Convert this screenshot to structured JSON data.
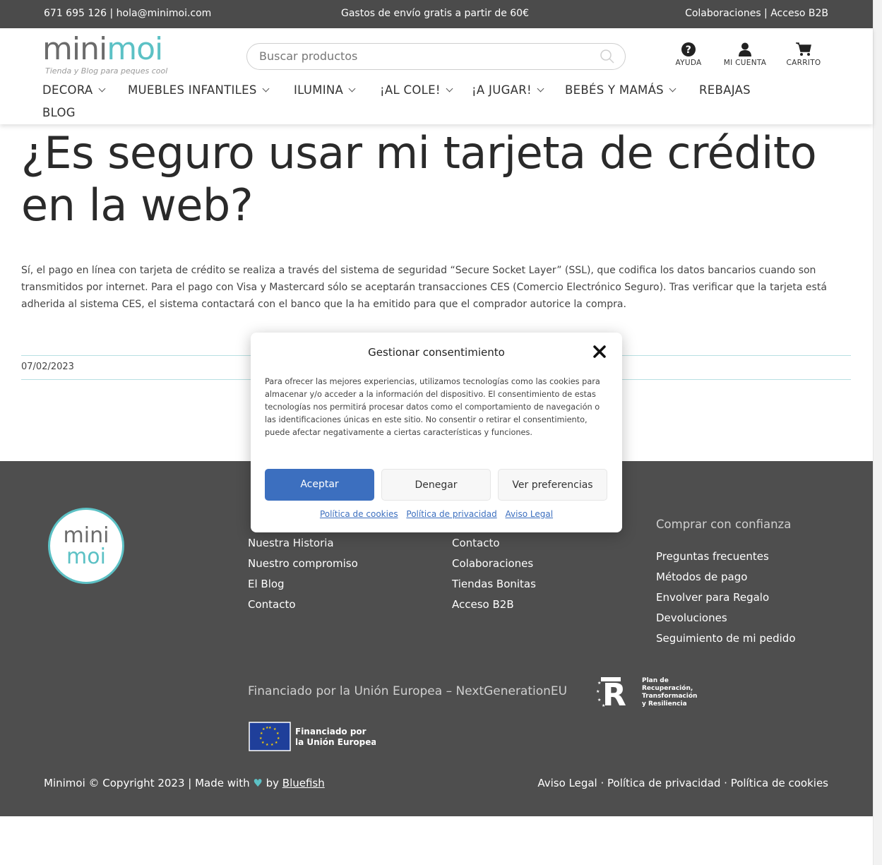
{
  "topbar": {
    "contact": "671 695 126 | hola@minimoi.com",
    "shipping": "Gastos de envío gratis a partir de 60€",
    "links": "Colaboraciones | Acceso B2B"
  },
  "header": {
    "logo_mini": "mini",
    "logo_moi": "moi",
    "logo_tagline": "Tienda y Blog para peques cool",
    "search_placeholder": "Buscar productos",
    "help_label": "AYUDA",
    "account_label": "MI CUENTA",
    "cart_label": "CARRITO",
    "icons": {
      "help": "question-circle-icon",
      "account": "user-icon",
      "cart": "cart-icon",
      "search": "search-icon"
    }
  },
  "nav": {
    "items": [
      {
        "label": "DECORA",
        "dropdown": true
      },
      {
        "label": "MUEBLES INFANTILES",
        "dropdown": true
      },
      {
        "label": "ILUMINA",
        "dropdown": true
      },
      {
        "label": "¡AL COLE!",
        "dropdown": true
      },
      {
        "label": "¡A JUGAR!",
        "dropdown": true
      },
      {
        "label": "BEBÉS Y MAMÁS",
        "dropdown": true
      },
      {
        "label": "REBAJAS",
        "dropdown": false
      },
      {
        "label": "BLOG",
        "dropdown": false
      }
    ]
  },
  "article": {
    "title": "¿Es seguro usar mi tarjeta de crédito en la web?",
    "body": "Sí, el pago en línea con tarjeta de crédito se realiza a través del sistema de seguridad “Secure Socket Layer” (SSL), que codifica los datos bancarios cuando son transmitidos por internet. Para el pago con Visa y Mastercard sólo se aceptarán transacciones CES (Comercio Electrónico Seguro). Tras verificar que la tarjeta está adherida al sistema CES, el sistema contactará con el banco que la ha emitido para que el comprador autorice la compra.",
    "date": "07/02/2023"
  },
  "consent": {
    "title": "Gestionar consentimiento",
    "text": "Para ofrecer las mejores experiencias, utilizamos tecnologías como las cookies para almacenar y/o acceder a la información del dispositivo. El consentimiento de estas tecnologías nos permitirá procesar datos como el comportamiento de navegación o las identificaciones únicas en este sitio. No consentir o retirar el consentimiento, puede afectar negativamente a ciertas características y funciones.",
    "accept": "Aceptar",
    "deny": "Denegar",
    "preferences": "Ver preferencias",
    "link_cookies": "Política de cookies",
    "link_privacy": "Política de privacidad",
    "link_legal": "Aviso Legal"
  },
  "footer": {
    "logo_mini": "mini",
    "logo_moi": "moi",
    "col1": {
      "heading": "",
      "links": [
        "Nuestra Historia",
        "Nuestro compromiso",
        "El Blog",
        "Contacto"
      ]
    },
    "col2": {
      "heading": "",
      "links": [
        "Contacto",
        "Colaboraciones",
        "Tiendas Bonitas",
        "Acceso B2B"
      ]
    },
    "col3": {
      "heading": "Comprar con confianza",
      "links": [
        "Preguntas frecuentes",
        "Métodos de pago",
        "Envolver para Regalo",
        "Devoluciones",
        "Seguimiento de mi pedido"
      ]
    },
    "eu_text": "Financiado por la Unión Europea – NextGenerationEU",
    "pr_lines": [
      "Plan de",
      "Recuperación,",
      "Transformación",
      "y Resiliencia"
    ],
    "eu_flag_lines": [
      "Financiado por",
      "la Unión Europea"
    ],
    "copyright_before": "Minimoi © Copyright 2023 | Made with",
    "copyright_by": "by",
    "copyright_link": "Bluefish",
    "legal_links": "Aviso Legal · Política de privacidad · Política de cookies",
    "colors": {
      "background": "#4e4e4e",
      "accent": "#5cc1c5"
    }
  }
}
